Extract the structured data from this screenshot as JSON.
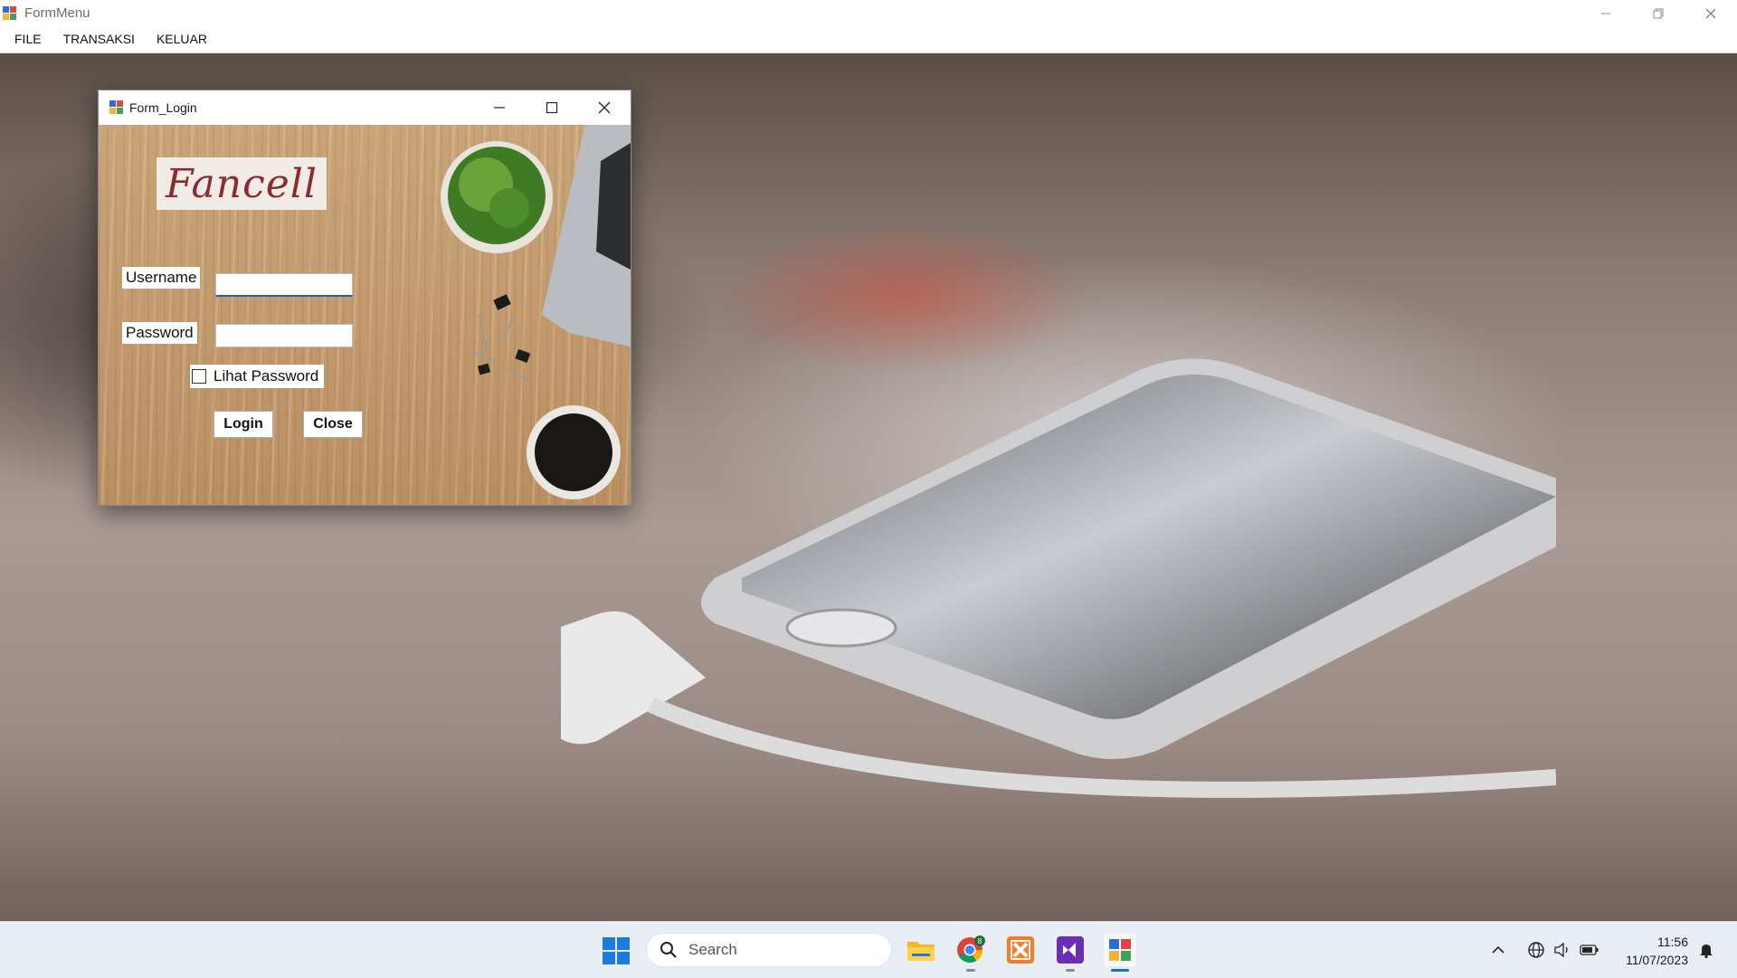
{
  "main_window": {
    "title": "FormMenu",
    "menu": [
      "FILE",
      "TRANSAKSI",
      "KELUAR"
    ]
  },
  "login_dialog": {
    "title": "Form_Login",
    "logo_text": "Fancell",
    "username_label": "Username",
    "username_value": "",
    "password_label": "Password",
    "password_value": "",
    "show_password_label": "Lihat Password",
    "show_password_checked": false,
    "login_button": "Login",
    "close_button": "Close"
  },
  "taskbar": {
    "search_placeholder": "Search",
    "apps": [
      "file-explorer-icon",
      "chrome-icon",
      "xampp-icon",
      "visual-studio-icon",
      "formmenu-app-icon"
    ],
    "chrome_badge": "8",
    "clock_time": "11:56",
    "clock_date": "11/07/2023"
  },
  "colors": {
    "accent_blue": "#2d5fa8",
    "logo_red": "#8c2a2f",
    "taskbar_bg": "#e9eef5"
  }
}
